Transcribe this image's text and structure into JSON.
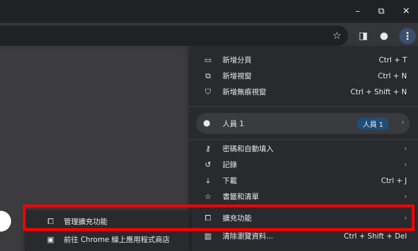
{
  "window": {
    "minimize_icon": "minimize-icon",
    "restore_icon": "restore-icon",
    "close_icon": "close-icon",
    "minimize": "–",
    "restore": "⧉",
    "close": "✕"
  },
  "menu": {
    "items": [
      {
        "icon": "new-tab-icon",
        "glyph": "⬚",
        "label": "新增分頁",
        "shortcut": "Ctrl + T"
      },
      {
        "icon": "new-window-icon",
        "glyph": "⧉",
        "label": "新增視窗",
        "shortcut": "Ctrl + N"
      },
      {
        "icon": "incognito-icon",
        "glyph": "⛉",
        "label": "新增無痕視窗",
        "shortcut": "Ctrl + Shift + N"
      },
      {
        "icon": "key-icon",
        "glyph": "⚷",
        "label": "密碼和自動填入"
      },
      {
        "icon": "history-icon",
        "glyph": "↺",
        "label": "記錄"
      },
      {
        "icon": "download-icon",
        "glyph": "⤓",
        "label": "下載",
        "shortcut": "Ctrl + J"
      },
      {
        "icon": "star-icon",
        "glyph": "☆",
        "label": "書籤和清單"
      },
      {
        "icon": "puzzle-icon",
        "glyph": "⧠",
        "label": "擴充功能"
      },
      {
        "icon": "trash-icon",
        "glyph": "🗑",
        "label": "清除瀏覽資料...",
        "shortcut": "Ctrl + Shift + Del"
      }
    ],
    "profile": {
      "label": "人員 1",
      "badge": "人員 1"
    }
  },
  "submenu": {
    "items": [
      {
        "icon": "puzzle-icon",
        "label": "管理擴充功能"
      },
      {
        "icon": "store-icon",
        "label": "前往 Chrome 線上應用程式商店"
      }
    ]
  },
  "colors": {
    "highlight": "#ff0000",
    "menu_bg": "#292a2d",
    "badge": "#1f4e79"
  }
}
